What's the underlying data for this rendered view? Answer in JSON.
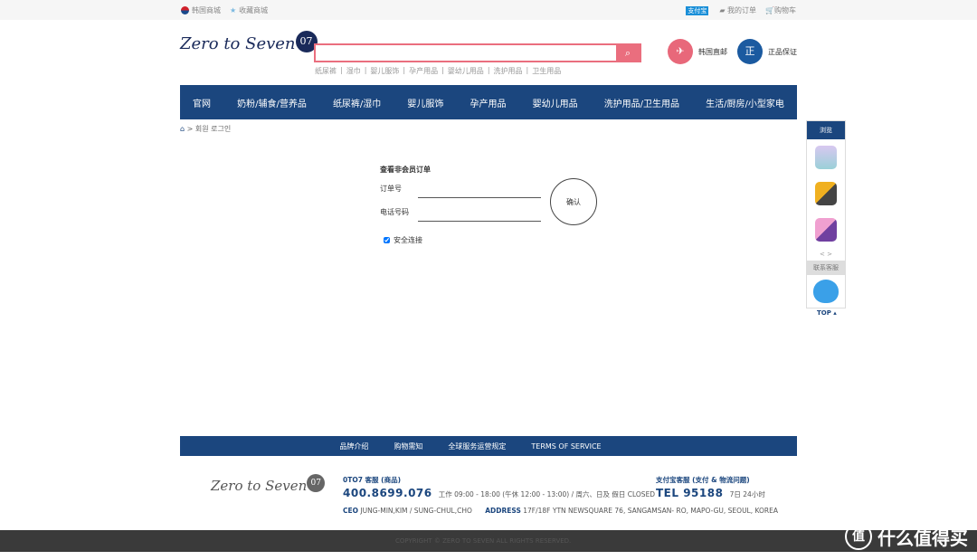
{
  "topbar": {
    "korea_mall": "韩国商城",
    "favorite": "收藏商城",
    "alipay": "支付宝",
    "orders": "我的订单",
    "cart": "购物车"
  },
  "header": {
    "logo": "Zero to Seven",
    "logo_mark": "07",
    "search_placeholder": "",
    "search_icon": "search-icon",
    "hot_links": [
      "纸尿裤",
      "湿巾",
      "婴儿服饰",
      "孕产用品",
      "婴幼儿用品",
      "洗护用品",
      "卫生用品"
    ],
    "badges": [
      {
        "icon": "airplane-icon",
        "label": "韩国直邮",
        "color": "#e8687a"
      },
      {
        "icon": "正",
        "label": "正品保证",
        "color": "#1b5aa0"
      }
    ]
  },
  "nav": [
    "官网",
    "奶粉/辅食/营养品",
    "纸尿裤/湿巾",
    "婴儿服饰",
    "孕产用品",
    "婴幼儿用品",
    "洗护用品/卫生用品",
    "生活/厨房/小型家电"
  ],
  "breadcrumb": {
    "home_icon": "home-icon",
    "text": "> 회원 로그인"
  },
  "form": {
    "title": "查看非会员订单",
    "order_label": "订单号",
    "order_value": "",
    "phone_label": "电话号码",
    "phone_value": "",
    "confirm": "确认",
    "secure": "安全连接",
    "secure_checked": true
  },
  "sidebar": {
    "header": "浏览",
    "arrows": "< >",
    "service": "联系客服",
    "top": "TOP ▴"
  },
  "footer": {
    "links": [
      "品牌介绍",
      "购物需知",
      "全球服务运营规定",
      "TERMS OF SERVICE"
    ],
    "logo": "Zero to Seven",
    "logo_mark": "07",
    "cs_title": "0TO7 客服 (商品)",
    "cs_phone": "400.8699.076",
    "cs_hours": "工作 09:00 - 18:00 (午休 12:00 - 13:00) / 周六、日及 假日 CLOSED",
    "alipay_title": "支付宝客服 (支付 & 物流问题)",
    "alipay_phone": "TEL 95188",
    "alipay_hours": "7日 24小时",
    "ceo_label": "CEO",
    "ceo": "JUNG-MIN,KIM / SUNG-CHUL,CHO",
    "address_label": "ADDRESS",
    "address": "17F/18F YTN NEWSQUARE 76, SANGAMSAN- RO, MAPO-GU, SEOUL, KOREA",
    "copyright": "COPYRIGHT © ZERO TO SEVEN ALL RIGHTS RESERVED."
  },
  "watermark": {
    "icon": "值",
    "text": "什么值得买"
  }
}
